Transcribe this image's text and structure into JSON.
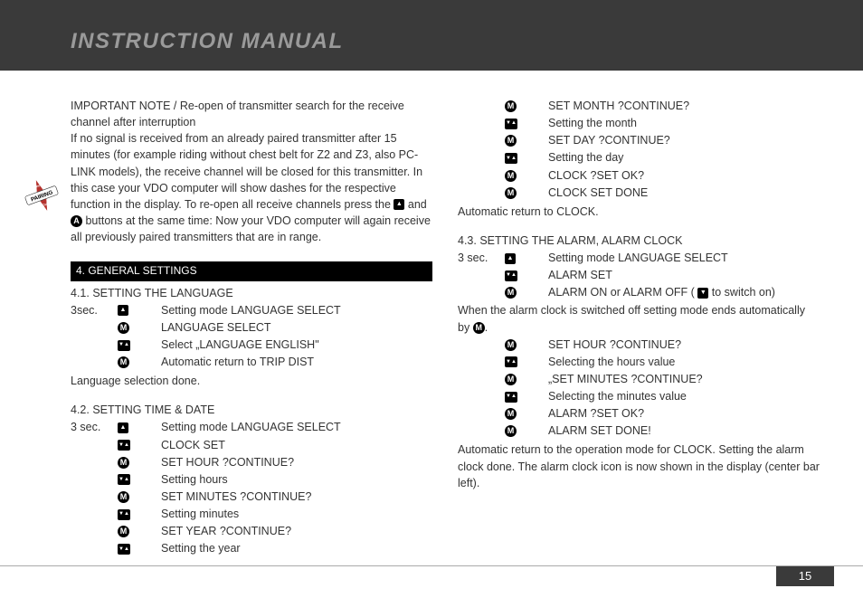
{
  "header": {
    "title": "INSTRUCTION MANUAL"
  },
  "badge": "PAIRING",
  "page_number": "15",
  "col1": {
    "important_note": "IMPORTANT NOTE / Re-open of transmitter search for the receive channel after interruption",
    "note_body_a": "If no signal is received from an already paired transmitter after 15 minutes (for example riding without chest belt for Z2 and Z3, also PC-LINK models), the receive channel will be closed for this transmitter. In this case your VDO computer will show dashes for the respective function in the display. To re-open all receive channels press the ",
    "note_body_b": " and ",
    "note_body_c": " buttons at the same time: Now your VDO computer will again receive all previously paired transmitters that are in range.",
    "section4": " 4. GENERAL SETTINGS",
    "s41": "4.1. SETTING THE LANGUAGE",
    "s41_pre": "3sec.",
    "s41_r1": "Setting mode LANGUAGE SELECT",
    "s41_r2": "LANGUAGE SELECT",
    "s41_r3": "Select „LANGUAGE ENGLISH\"",
    "s41_r4": "Automatic return to TRIP DIST",
    "s41_done": "Language selection done.",
    "s42": "4.2. SETTING TIME & DATE",
    "s42_pre": "3 sec.",
    "s42_r1": "Setting mode LANGUAGE SELECT",
    "s42_r2": "CLOCK SET",
    "s42_r3": "SET HOUR ?CONTINUE?",
    "s42_r4": "Setting hours",
    "s42_r5": "SET MINUTES ?CONTINUE?",
    "s42_r6": "Setting minutes",
    "s42_r7": "SET YEAR ?CONTINUE?",
    "s42_r8": "Setting the year"
  },
  "col2": {
    "s42_r9": "SET MONTH ?CONTINUE?",
    "s42_r10": "Setting the month",
    "s42_r11": "SET DAY ?CONTINUE?",
    "s42_r12": "Setting the day",
    "s42_r13": "CLOCK ?SET OK?",
    "s42_r14": "CLOCK SET DONE",
    "s42_done": "Automatic return to CLOCK.",
    "s43": "4.3. SETTING THE ALARM, ALARM CLOCK",
    "s43_pre": "3 sec.",
    "s43_r1": "Setting mode LANGUAGE SELECT",
    "s43_r2": "ALARM SET",
    "s43_r3a": "ALARM ON or ALARM OFF ( ",
    "s43_r3b": " to switch on)",
    "s43_mid_a": "When the alarm clock is switched off setting mode ends automatically by ",
    "s43_mid_b": ".",
    "s43_r4": "SET HOUR ?CONTINUE?",
    "s43_r5": "Selecting the hours value",
    "s43_r6": "„SET MINUTES ?CONTINUE?",
    "s43_r7": "Selecting the minutes value",
    "s43_r8": "ALARM ?SET OK?",
    "s43_r9": "ALARM SET DONE!",
    "s43_done": "Automatic return to the operation mode for CLOCK. Setting the alarm clock done. The alarm clock icon is now shown in the display (center bar left)."
  }
}
